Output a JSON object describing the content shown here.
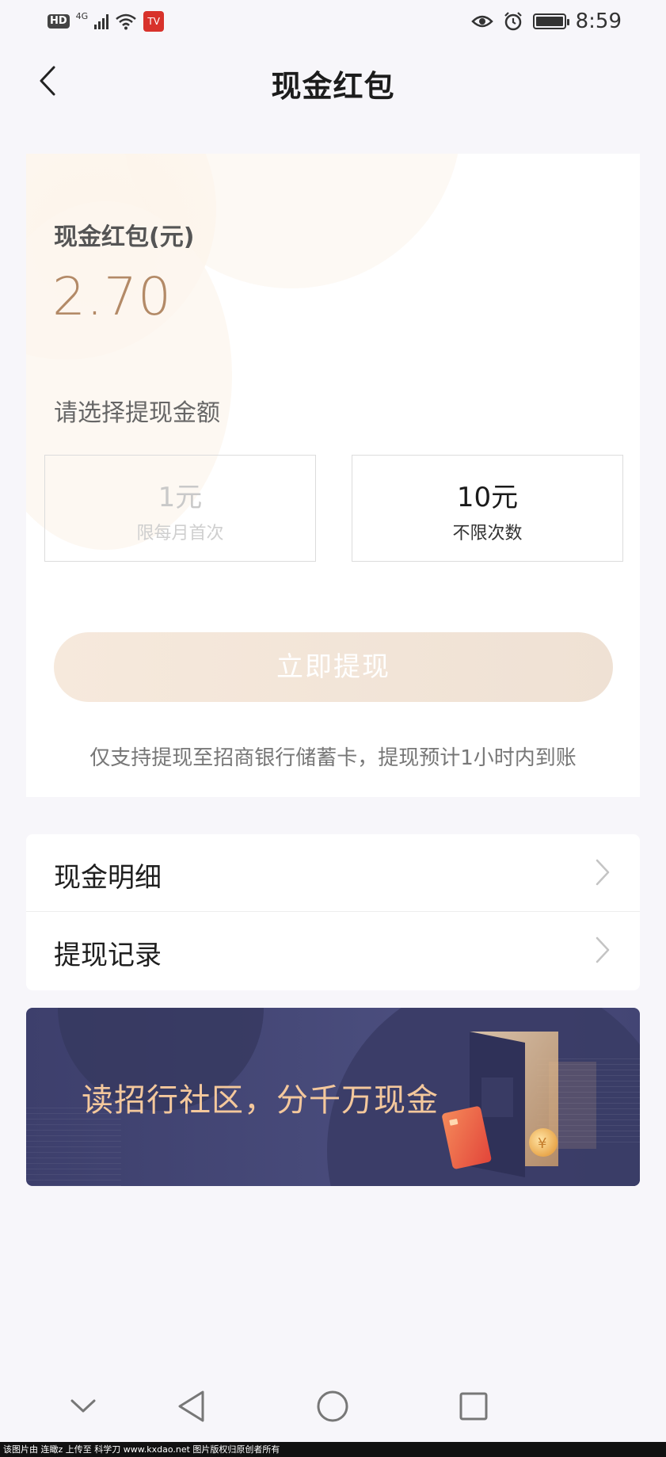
{
  "status_bar": {
    "hd": "HD",
    "network": "4G",
    "app_badge": "TV",
    "time": "8:59"
  },
  "header": {
    "title": "现金红包"
  },
  "balance": {
    "label": "现金红包(元)",
    "value": "2.70"
  },
  "withdraw": {
    "choose_label": "请选择提现金额",
    "options": [
      {
        "amount": "1元",
        "note": "限每月首次",
        "enabled": false
      },
      {
        "amount": "10元",
        "note": "不限次数",
        "enabled": true
      }
    ],
    "button_label": "立即提现",
    "note": "仅支持提现至招商银行储蓄卡，提现预计1小时内到账"
  },
  "list": {
    "items": [
      {
        "label": "现金明细"
      },
      {
        "label": "提现记录"
      }
    ]
  },
  "banner": {
    "text": "读招行社区，分千万现金"
  },
  "footer": {
    "text": "该图片由 连瞰z 上传至 科学刀 www.kxdao.net 图片版权归原创者所有"
  },
  "colors": {
    "accent": "#b38a67",
    "banner_bg": "#43456f",
    "banner_text": "#f4c89c",
    "button_bg": "#f3e6d9"
  }
}
